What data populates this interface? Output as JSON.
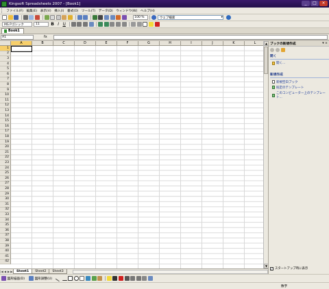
{
  "window": {
    "title": "Kingsoft Spreadsheets 2007 - [Book1]",
    "controls": [
      "_",
      "□",
      "×"
    ]
  },
  "menubar": {
    "items": [
      "ファイル(F)",
      "編集(E)",
      "表示(V)",
      "挿入(I)",
      "書式(O)",
      "ツール(T)",
      "データ(D)",
      "ウィンドウ(W)",
      "ヘルプ(H)"
    ],
    "zoom": "100 %",
    "ask_placeholder": "ウェブ検索"
  },
  "format": {
    "font_name": "MS Pゴシック",
    "font_size": "11",
    "bold": "B",
    "italic": "I",
    "underline": "U"
  },
  "document_tab": {
    "label": "Book1"
  },
  "formula_bar": {
    "name_box": "A1",
    "fx": "fx"
  },
  "grid": {
    "columns": [
      "A",
      "B",
      "C",
      "D",
      "E",
      "F",
      "G",
      "H",
      "I",
      "J",
      "K",
      "L"
    ],
    "rows": [
      "1",
      "2",
      "3",
      "4",
      "5",
      "6",
      "7",
      "8",
      "9",
      "10",
      "11",
      "12",
      "13",
      "14",
      "15",
      "16",
      "17",
      "18",
      "19",
      "20",
      "21",
      "22",
      "23",
      "24",
      "25",
      "26",
      "27",
      "28",
      "29",
      "30",
      "31",
      "32",
      "33",
      "34",
      "35",
      "36",
      "37",
      "38",
      "39",
      "40",
      "41",
      "42"
    ],
    "active_cell": "A1"
  },
  "sheet_tabs": [
    "Sheet1",
    "Sheet2",
    "Sheet3"
  ],
  "taskpane": {
    "title": "ブックの新規作成",
    "section_open": "開く",
    "open_link": "開く...",
    "section_new": "新規作成",
    "new_links": [
      "新規空白ブック",
      "既定のテンプレート",
      "このコンピューター上のテンプレート..."
    ],
    "startup_label": "スタートアップ時に表示",
    "startup_checked": true
  },
  "drawbar": {
    "draw_label": "図形描画(D)",
    "autoshape_label": "図形調整(U)"
  },
  "status": {
    "text": "数字"
  }
}
